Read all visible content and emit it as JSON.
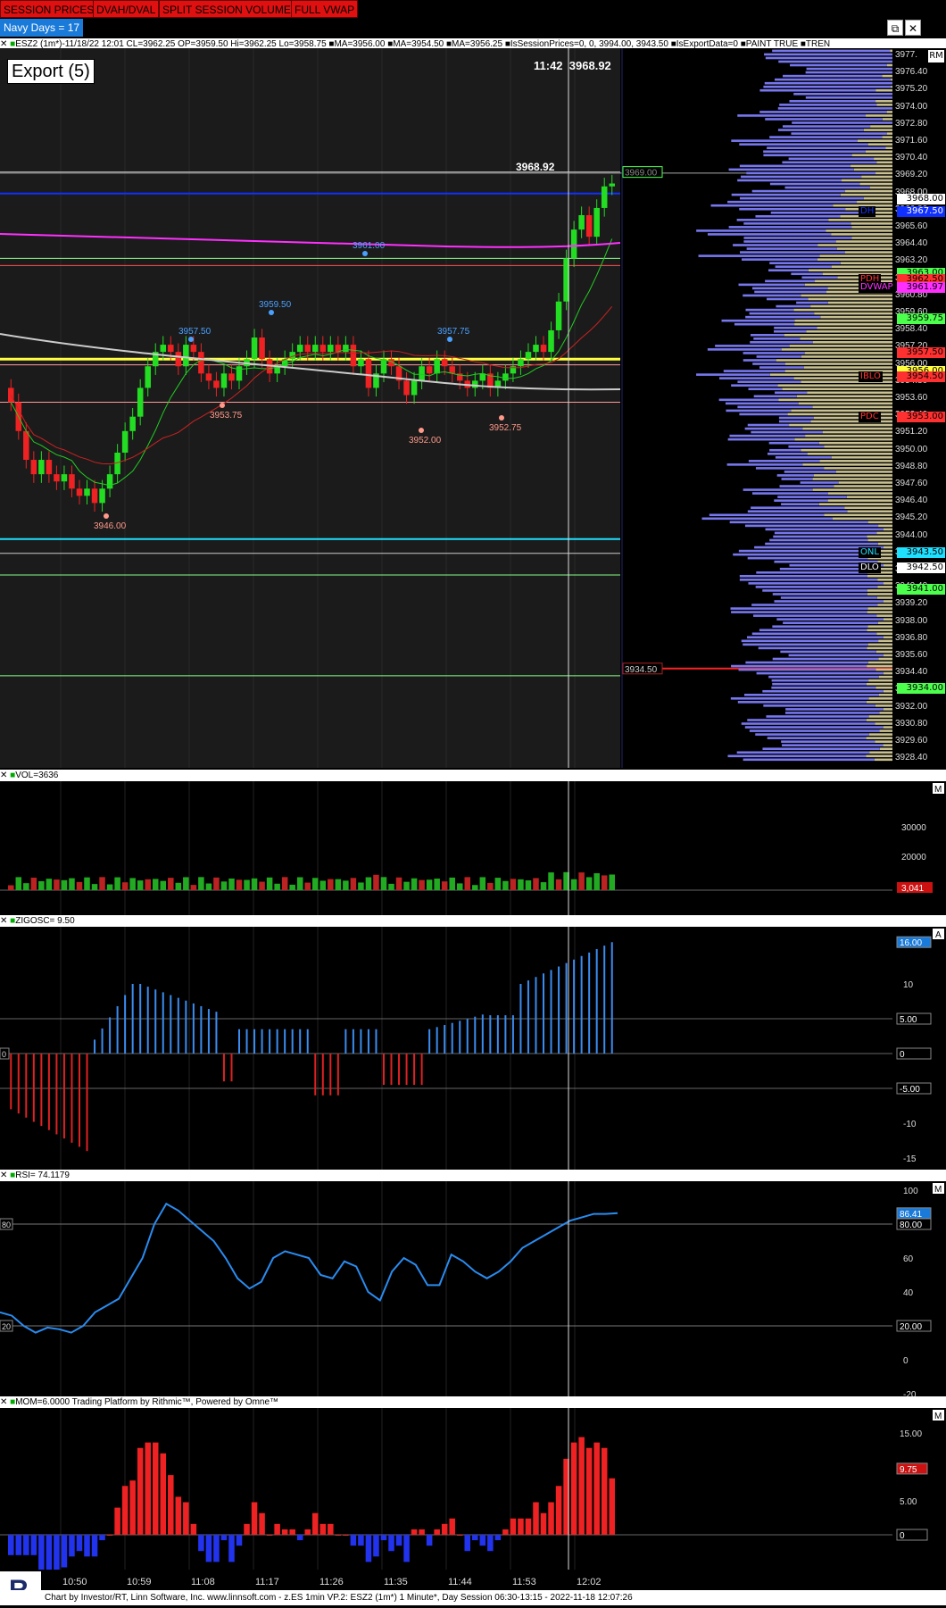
{
  "toolbar": {
    "buttons": [
      "SESSION PRICES",
      "DVAH/DVAL",
      "SPLIT SESSION VOLUME",
      "FULL VWAP"
    ],
    "navy_days": "Navy Days = 17",
    "window_buttons": {
      "restore": "⧉",
      "close": "✕"
    },
    "rm": "RM"
  },
  "main_pane": {
    "header": "ESZ2 (1m*)-11/18/22 12:01 CL=3962.25 OP=3959.50 Hi=3962.25 Lo=3958.75  ■MA=3956.00  ■MA=3954.50  ■MA=3956.25  ■IsSessionPrices=0, 0, 3994.00, 3943.50  ■IsExportData=0  ■PAINT TRUE  ■TREN",
    "export_label": "Export (5)",
    "cursor_time": "11:42",
    "cursor_price": "3968.92",
    "cursor_line_price": "3968.92",
    "box_price_top": "3969.00",
    "box_price_bottom": "3934.50",
    "swing_labels": [
      {
        "text": "3961.00",
        "color": "#4aa0ff"
      },
      {
        "text": "3959.50",
        "color": "#4aa0ff"
      },
      {
        "text": "3957.50",
        "color": "#4aa0ff"
      },
      {
        "text": "3957.75",
        "color": "#4aa0ff"
      },
      {
        "text": "3953.75",
        "color": "#ff9a8a"
      },
      {
        "text": "3952.00",
        "color": "#ff9a8a"
      },
      {
        "text": "3952.75",
        "color": "#ff9a8a"
      },
      {
        "text": "3946.00",
        "color": "#ff9a8a"
      }
    ]
  },
  "price_axis": {
    "ticks": [
      "3977.",
      "3976.40",
      "3975.20",
      "3974.00",
      "3972.80",
      "3971.60",
      "3970.40",
      "3969.20",
      "3968.00",
      "3966.80",
      "3965.60",
      "3964.40",
      "3963.20",
      "3962.00",
      "3960.80",
      "3959.60",
      "3958.40",
      "3957.20",
      "3956.00",
      "3954.80",
      "3953.60",
      "3952.40",
      "3951.20",
      "3950.00",
      "3948.80",
      "3947.60",
      "3946.40",
      "3945.20",
      "3944.00",
      "3942.80",
      "3941.60",
      "3940.40",
      "3939.20",
      "3938.00",
      "3936.80",
      "3935.60",
      "3934.40",
      "3933.20",
      "3932.00",
      "3930.80",
      "3929.60",
      "3928.40"
    ],
    "tags": [
      {
        "label": "",
        "value": "3968.00",
        "bg": "#fff",
        "fg": "#000"
      },
      {
        "label": "DH",
        "value": "3967.50",
        "bg": "#1030ff",
        "fg": "#1030ff"
      },
      {
        "label": "",
        "value": "3963.00",
        "bg": "#4dff4d",
        "fg": "#000"
      },
      {
        "label": "PDH",
        "value": "3962.50",
        "bg": "#ff3030",
        "fg": "#000"
      },
      {
        "label": "DVWAP",
        "value": "3961.97",
        "bg": "#ff30ff",
        "fg": "#000"
      },
      {
        "label": "",
        "value": "3959.75",
        "bg": "#4dff4d",
        "fg": "#000"
      },
      {
        "label": "",
        "value": "3957.50",
        "bg": "#ff3030",
        "fg": "#000"
      },
      {
        "label": "",
        "value": "3956.00",
        "bg": "#ffff40",
        "fg": "#000"
      },
      {
        "label": "IBLO",
        "value": "3954.50",
        "bg": "#ff3030",
        "fg": "#000"
      },
      {
        "label": "PDC",
        "value": "3953.00",
        "bg": "#ff3030",
        "fg": "#000"
      },
      {
        "label": "ONL",
        "value": "3943.50",
        "bg": "#20e0ff",
        "fg": "#000"
      },
      {
        "label": "DLO",
        "value": "3942.50",
        "bg": "#ffffff",
        "fg": "#000"
      },
      {
        "label": "",
        "value": "3941.00",
        "bg": "#4dff4d",
        "fg": "#000"
      },
      {
        "label": "",
        "value": "3934.00",
        "bg": "#4dff4d",
        "fg": "#000"
      }
    ]
  },
  "vol_pane": {
    "header": "VOL=3636",
    "ticks": [
      "30000",
      "20000",
      "10000"
    ],
    "tag": "3,041",
    "marker": "M"
  },
  "zig_pane": {
    "header": "ZIGOSC= 9.50",
    "ticks": [
      "10",
      "-10",
      "-15"
    ],
    "tags": [
      "16.00",
      "5.00",
      "0",
      "-5.00"
    ],
    "marker": "A",
    "left_tag": "0"
  },
  "rsi_pane": {
    "header": "RSI= 74.1179",
    "ticks": [
      "100",
      "60",
      "40",
      "0",
      "-20"
    ],
    "tags": [
      "86.41",
      "80.00",
      "20.00"
    ],
    "left_tags": [
      "80",
      "20"
    ],
    "marker": "M"
  },
  "mom_pane": {
    "header": "MOM=6.0000  Trading Platform by Rithmic™, Powered by Omne™",
    "ticks": [
      "15.00",
      "5.00"
    ],
    "tags": [
      "9.75",
      "0"
    ],
    "marker": "M"
  },
  "x_axis": {
    "labels": [
      "10:50",
      "10:59",
      "11:08",
      "11:17",
      "11:26",
      "11:35",
      "11:44",
      "11:53",
      "12:02"
    ]
  },
  "footer": "Chart by Investor/RT, Linn Software, Inc. www.linnsoft.com - z.ES 1min VP.2: ESZ2 (1m*) 1 Minute*, Day Session 06:30-13:15 - 2022-11-18 12:07:26",
  "colors": {
    "up": "#22dd22",
    "down": "#ee2222",
    "zig_up": "#3b8cf0",
    "zig_down": "#dd2222",
    "rsi": "#2a8cf0",
    "profile_blue": "#7777ee",
    "profile_tan": "#c8c090"
  }
}
